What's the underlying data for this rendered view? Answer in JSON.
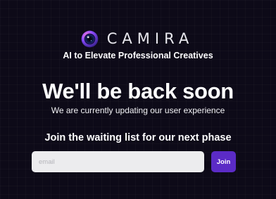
{
  "brand": {
    "logo_icon": "camera-lens-icon",
    "name": "CAMIRA"
  },
  "tagline": "AI to Elevate Professional Creatives",
  "headline": "We'll be back soon",
  "subtext": "We are currently updating our user experience",
  "waitlist": {
    "title": "Join the waiting list for our next phase",
    "email_placeholder": "email",
    "email_value": "",
    "join_label": "Join"
  },
  "colors": {
    "background": "#0d0a18",
    "accent": "#5b2bc6",
    "input_background": "#ececee"
  }
}
